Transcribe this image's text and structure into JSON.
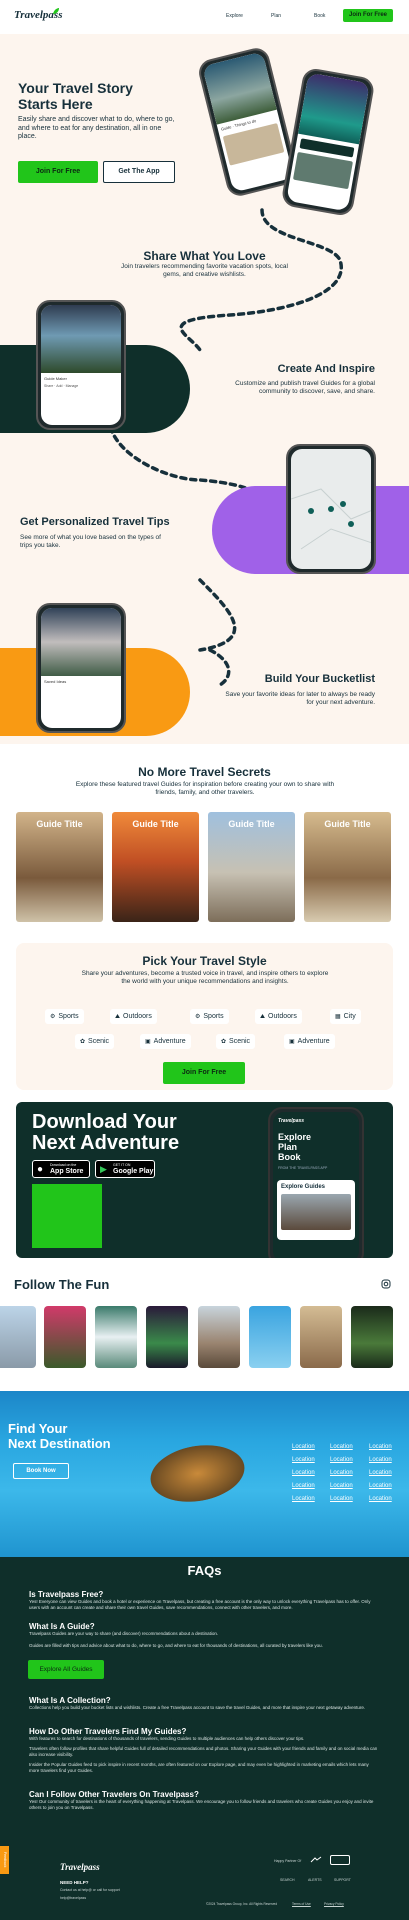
{
  "nav": {
    "logo": "Travelpass",
    "links": [
      "Explore",
      "Plan",
      "Book"
    ],
    "cta": "Join For Free"
  },
  "hero": {
    "title_line1": "Your Travel Story",
    "title_line2": "Starts Here",
    "subtitle": "Easily share and discover what to do, where to go, and where to eat for any destination, all in one place.",
    "primary_button": "Join For Free",
    "secondary_button": "Get The App"
  },
  "share": {
    "title": "Share What You Love",
    "subtitle": "Join travelers recommending favorite vacation spots, local gems, and creative wishlists."
  },
  "create": {
    "title": "Create And Inspire",
    "subtitle": "Customize and publish travel Guides for a global community to discover, save, and share."
  },
  "tips": {
    "title": "Get Personalized Travel Tips",
    "subtitle": "See more of what you love based on the types of trips you take."
  },
  "bucketlist": {
    "title": "Build Your Bucketlist",
    "subtitle": "Save your favorite ideas for later to always be ready for your next adventure."
  },
  "secrets": {
    "title": "No More Travel Secrets",
    "subtitle": "Explore these featured travel Guides for inspiration before creating your own to share with friends, family, and other travelers.",
    "guides": [
      "Guide Title",
      "Guide Title",
      "Guide Title",
      "Guide Title"
    ]
  },
  "style": {
    "title": "Pick Your Travel Style",
    "subtitle": "Share your adventures, become a trusted voice in travel, and inspire others to explore the world with your unique recommendations and insights.",
    "row1": [
      "Sports",
      "Outdoors",
      "Sports",
      "Outdoors",
      "City"
    ],
    "row2": [
      "Scenic",
      "Adventure",
      "Scenic",
      "Adventure"
    ],
    "cta": "Join For Free"
  },
  "download": {
    "title_line1": "Download Your",
    "title_line2": "Next Adventure",
    "appstore_small": "Download on the",
    "appstore": "App Store",
    "google_small": "GET IT ON",
    "google": "Google Play",
    "phone_title": "Explore Plan Book",
    "phone_sub": "FROM THE TRAVELPASS APP",
    "phone_card": "Explore Guides",
    "phone_logo": "Travelpass"
  },
  "follow": {
    "title": "Follow The Fun"
  },
  "destination": {
    "title_line1": "Find Your",
    "title_line2": "Next Destination",
    "button": "Book Now",
    "locations": [
      "Location",
      "Location",
      "Location",
      "Location",
      "Location",
      "Location",
      "Location",
      "Location",
      "Location",
      "Location",
      "Location",
      "Location",
      "Location",
      "Location",
      "Location"
    ]
  },
  "faq": {
    "title": "FAQs",
    "items": [
      {
        "q": "Is Travelpass Free?",
        "a": "Yes! Everyone can view Guides and book a hotel or experience on Travelpass, but creating a free account is the only way to unlock everything Travelpass has to offer. Only users with an account can create and share their own travel Guides, save recommendations, connect with other travelers, and more."
      },
      {
        "q": "What Is A Guide?",
        "a": "Travelpass Guides are your way to share (and discover) recommendations about a destination."
      },
      {
        "q": "",
        "a": "Guides are filled with tips and advice about what to do, where to go, and where to eat for thousands of destinations, all curated by travelers like you."
      },
      {
        "q": "What Is A Collection?",
        "a": "Collections help you build your bucket lists and wishlists. Create a free Travelpass account to save the travel Guides, and more that inspire your next getaway adventure."
      },
      {
        "q": "How Do Other Travelers Find My Guides?",
        "a": "With features to search for destinations of thousands of travelers, sending Guides to multiple audiences can help others discover your tips."
      },
      {
        "q": "",
        "a": "Travelers often follow profiles that share helpful Guides full of detailed recommendations and photos. Sharing your Guides with your friends and family and on social media can also increase visibility."
      },
      {
        "q": "",
        "a": "Insider the Popular Guides feed to pick inspire in recent months, are often featured on our Explore page, and may even be highlighted in marketing emails which lets many more travelers find your Guides."
      },
      {
        "q": "Can I Follow Other Travelers On Travelpass?",
        "a": "Yes! Our community of travelers is the heart of everything happening at Travelpass. We encourage you to follow friends and travelers who create Guides you enjoy and invite others to join you on Travelpass."
      }
    ],
    "button": "Explore All Guides"
  },
  "footer": {
    "logo": "Travelpass",
    "help": "NEED HELP?",
    "help_line": "Contact us at help@ or call for support",
    "help_email": "help@travelpass",
    "partner_label": "Happy Partner Of",
    "links": [
      "SEARCH",
      "ALERTS",
      "SUPPORT"
    ],
    "copyright": "©2024 Travelpass Group, Inc. All Rights Reserved",
    "terms": "Terms of Use",
    "privacy": "Privacy Policy",
    "feedback": "Feedback"
  },
  "colors": {
    "brand_green": "#21c51a",
    "dark_teal": "#0f2f2a",
    "cream": "#fdf5ee",
    "purple": "#a061e8",
    "orange": "#f99a13"
  }
}
